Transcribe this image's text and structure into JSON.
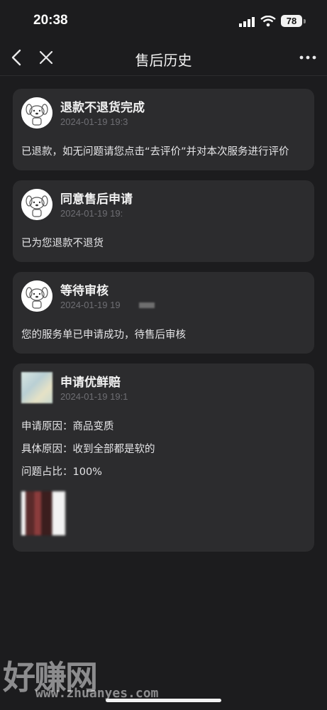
{
  "status_bar": {
    "time": "20:38",
    "battery": "78"
  },
  "nav": {
    "title": "售后历史"
  },
  "cards": [
    {
      "title": "退款不退货完成",
      "time": "2024-01-19 19:3",
      "lines": [
        "已退款，如无问题请您点击“去评价”并对本次服务进行评价"
      ]
    },
    {
      "title": "同意售后申请",
      "time": "2024-01-19 19:",
      "lines": [
        "已为您退款不退货"
      ]
    },
    {
      "title": "等待审核",
      "time": "2024-01-19 19",
      "lines": [
        "您的服务单已申请成功，待售后审核"
      ]
    },
    {
      "title": "申请优鲜赔",
      "time": "2024-01-19 19:1",
      "lines": [
        "申请原因：商品变质",
        "具体原因：收到全部都是软的",
        "问题占比：100%"
      ]
    }
  ],
  "watermark": {
    "brand": "好赚网",
    "url": "www.zhuanyes.com"
  }
}
